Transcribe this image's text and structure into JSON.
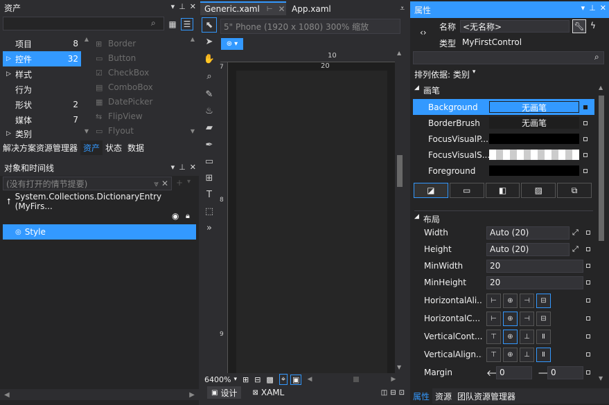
{
  "assets": {
    "title": "资产",
    "categories": [
      {
        "label": "项目",
        "count": "8"
      },
      {
        "label": "控件",
        "count": "32"
      },
      {
        "label": "样式",
        "count": ""
      },
      {
        "label": "行为",
        "count": ""
      },
      {
        "label": "形状",
        "count": "2"
      },
      {
        "label": "媒体",
        "count": "7"
      },
      {
        "label": "类别",
        "count": ""
      }
    ],
    "controls": [
      "Border",
      "Button",
      "CheckBox",
      "ComboBox",
      "DatePicker",
      "FlipView",
      "Flyout"
    ],
    "bottom_tabs": [
      "解决方案资源管理器",
      "资产",
      "状态",
      "数据"
    ]
  },
  "objects": {
    "title": "对象和时间线",
    "storyboard_placeholder": "(没有打开的情节提要)",
    "root_item": "System.Collections.DictionaryEntry (MyFirs...",
    "style_item": "Style"
  },
  "editor": {
    "tabs": [
      "Generic.xaml",
      "App.xaml"
    ],
    "device": "5\" Phone (1920 x 1080) 300% 缩放",
    "ruler_top_1": "10",
    "ruler_top_2": "20",
    "ruler_left_1": "7",
    "ruler_left_2": "8",
    "ruler_left_3": "9",
    "zoom": "6400%",
    "view_tabs": [
      "设计",
      "XAML"
    ]
  },
  "properties": {
    "title": "属性",
    "name_label": "名称",
    "name_value": "<无名称>",
    "type_label": "类型",
    "type_value": "MyFirstControl",
    "sort_label": "排列依据: 类别",
    "brush_section": "画笔",
    "brushes": [
      {
        "name": "Background",
        "value": "无画笔"
      },
      {
        "name": "BorderBrush",
        "value": "无画笔"
      },
      {
        "name": "FocusVisualP...",
        "value": ""
      },
      {
        "name": "FocusVisualS...",
        "value": ""
      },
      {
        "name": "Foreground",
        "value": ""
      }
    ],
    "layout_section": "布局",
    "layout": [
      {
        "name": "Width",
        "value": "Auto (20)"
      },
      {
        "name": "Height",
        "value": "Auto (20)"
      },
      {
        "name": "MinWidth",
        "value": "20"
      },
      {
        "name": "MinHeight",
        "value": "20"
      }
    ],
    "align_rows": [
      "HorizontalAli...",
      "HorizontalC...",
      "VerticalCont...",
      "VerticalAlign..."
    ],
    "margin_label": "Margin",
    "margin_values": [
      "0",
      "0"
    ],
    "bottom_tabs": [
      "属性",
      "资源",
      "团队资源管理器"
    ]
  }
}
